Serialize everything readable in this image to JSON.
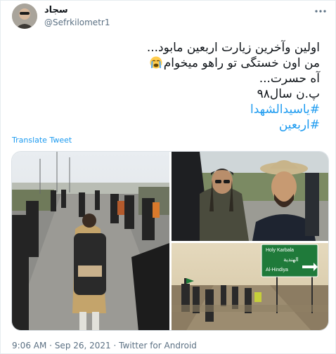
{
  "tweet": {
    "author_name": "سجاد",
    "author_handle": "@Sefrkilometr1",
    "more_icon": "more-horizontal-icon",
    "lines": [
      {
        "text": "اولین وآخرین زیارت اربعین مابود..."
      },
      {
        "text": "من اون خستگی تو راهو میخوام",
        "emoji": "crying-face-emoji"
      },
      {
        "text": "آه حسرت..."
      },
      {
        "text": "پ.ن سال۹۸"
      }
    ],
    "hashtags": [
      "#یاسیدالشهدا",
      "#اربعین"
    ],
    "translate_label": "Translate Tweet",
    "time": "9:06 AM",
    "date": "Sep 26, 2021",
    "separator": "·",
    "source": "Twitter for Android"
  },
  "media": {
    "photos": [
      {
        "name": "pilgrims-walking-photo"
      },
      {
        "name": "pilgrims-selfie-photo"
      },
      {
        "name": "karbala-road-sign-photo",
        "sign_line_1": "Holy Karbala",
        "sign_line_2": "الهندية",
        "sign_line_3": "Al-Hindiya"
      }
    ]
  },
  "colors": {
    "link": "#1d9bf0",
    "secondary_text": "#5b7083",
    "sign_green": "#1f7a3a"
  }
}
